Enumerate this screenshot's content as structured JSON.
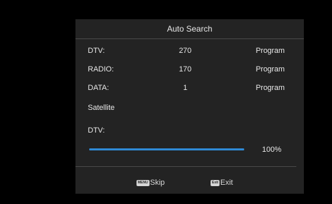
{
  "dialog": {
    "title": "Auto Search"
  },
  "results": [
    {
      "label": "DTV:",
      "count": "270",
      "unit": "Program"
    },
    {
      "label": "RADIO:",
      "count": "170",
      "unit": "Program"
    },
    {
      "label": "DATA:",
      "count": "1",
      "unit": "Program"
    }
  ],
  "satellite_label": "Satellite",
  "scan": {
    "type_label": "DTV:",
    "progress_percent": 100,
    "progress_text": "100%"
  },
  "footer": {
    "skip_key": "MENU",
    "skip_label": "Skip",
    "exit_key": "Exit",
    "exit_label": "Exit"
  },
  "colors": {
    "panel_bg": "#232323",
    "progress_fill": "#2f8ad6",
    "text": "#e8e8e8"
  }
}
